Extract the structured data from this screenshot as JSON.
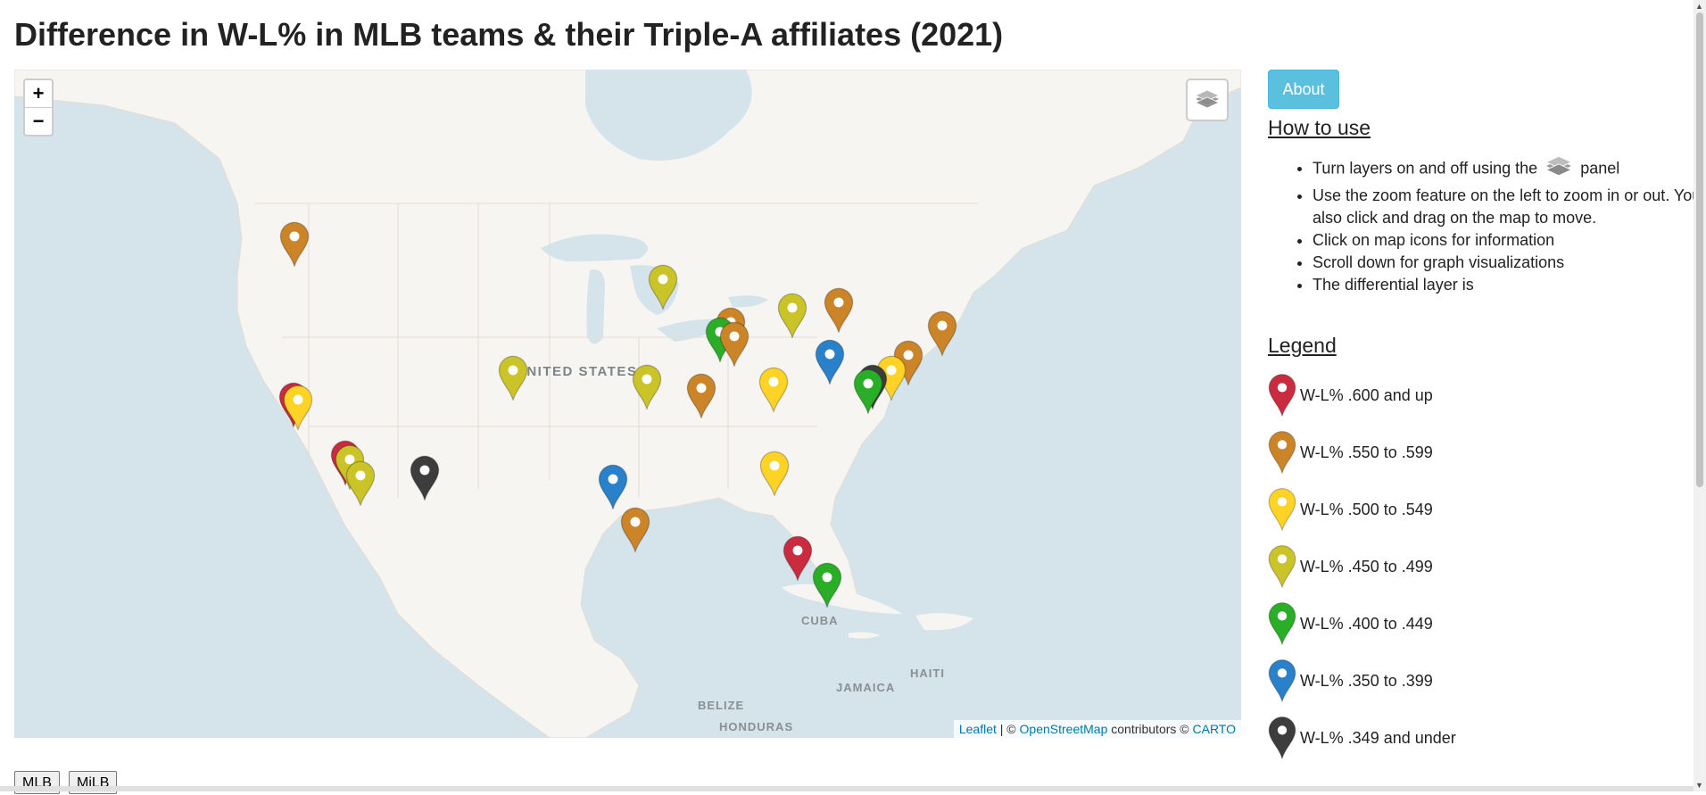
{
  "title": "Difference in W-L% in MLB teams & their Triple-A affiliates (2021)",
  "map": {
    "zoom_in": "+",
    "zoom_out": "−",
    "layers_icon": "layers-icon",
    "labels": {
      "united_states": "UNITED STATES",
      "cuba": "CUBA",
      "belize": "BELIZE",
      "honduras": "HONDURAS",
      "jamaica": "JAMAICA",
      "haiti": "HAITI"
    },
    "attribution": {
      "leaflet": "Leaflet",
      "sep": " | © ",
      "osm": "OpenStreetMap",
      "contributors": " contributors © ",
      "carto": "CARTO"
    },
    "marker_colors": {
      "red": "#cb2b3e",
      "orange": "#cb8427",
      "gold": "#ffd326",
      "yellow": "#cac428",
      "green": "#2aad27",
      "blue": "#2a81cb",
      "black": "#3d3d3d"
    }
  },
  "sidebar": {
    "about_label": "About",
    "howto_heading": "How to use",
    "howto_items": {
      "item1_before": "Turn layers on and off using the",
      "item1_after": "panel",
      "item2": "Use the zoom feature on the left to zoom in or out. You can also click and drag on the map to move.",
      "item3": "Click on map icons for information",
      "item4": "Scroll down for graph visualizations",
      "item5": "The differential layer is"
    },
    "legend_heading": "Legend",
    "legend": [
      {
        "label": "W-L% .600 and up",
        "color": "#cb2b3e"
      },
      {
        "label": "W-L% .550 to .599",
        "color": "#cb8427"
      },
      {
        "label": "W-L% .500 to .549",
        "color": "#ffd326"
      },
      {
        "label": "W-L% .450 to .499",
        "color": "#cac428"
      },
      {
        "label": "W-L% .400 to .449",
        "color": "#2aad27"
      },
      {
        "label": "W-L% .350 to .399",
        "color": "#2a81cb"
      },
      {
        "label": "W-L% .349 and under",
        "color": "#3d3d3d"
      }
    ]
  },
  "tabs": {
    "mlb": "MLB",
    "milb": "MiLB"
  }
}
